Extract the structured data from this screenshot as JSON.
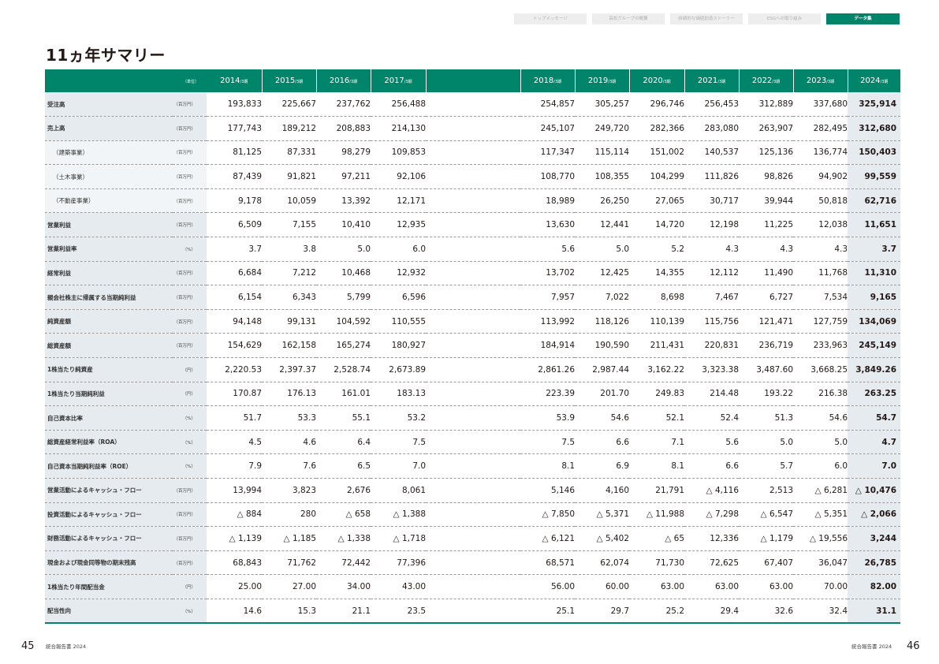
{
  "nav": {
    "tabs": [
      {
        "label": "トップメッセージ",
        "active": false
      },
      {
        "label": "高松グループの概要",
        "active": false
      },
      {
        "label": "持続的な価値創造ストーリー",
        "active": false
      },
      {
        "label": "ESGへの取り組み",
        "active": false
      },
      {
        "label": "データ集",
        "active": true
      }
    ]
  },
  "page_title": "11ヵ年サマリー",
  "table": {
    "unit_header": "（単位）",
    "years": [
      {
        "y": "2014",
        "s": "/3期"
      },
      {
        "y": "2015",
        "s": "/3期"
      },
      {
        "y": "2016",
        "s": "/3期"
      },
      {
        "y": "2017",
        "s": "/3期"
      },
      {
        "y": "2018",
        "s": "/3期"
      },
      {
        "y": "2019",
        "s": "/3期"
      },
      {
        "y": "2020",
        "s": "/3期"
      },
      {
        "y": "2021",
        "s": "/3期"
      },
      {
        "y": "2022",
        "s": "/3期"
      },
      {
        "y": "2023",
        "s": "/3期"
      },
      {
        "y": "2024",
        "s": "/3期"
      }
    ],
    "rows": [
      {
        "label": "受注高",
        "unit": "（百万円）",
        "sub": false,
        "values": [
          "193,833",
          "225,667",
          "237,762",
          "256,488",
          "254,857",
          "305,257",
          "296,746",
          "256,453",
          "312,889",
          "337,680",
          "325,914"
        ]
      },
      {
        "label": "売上高",
        "unit": "（百万円）",
        "sub": false,
        "values": [
          "177,743",
          "189,212",
          "208,883",
          "214,130",
          "245,107",
          "249,720",
          "282,366",
          "283,080",
          "263,907",
          "282,495",
          "312,680"
        ]
      },
      {
        "label": "（建築事業）",
        "unit": "（百万円）",
        "sub": true,
        "values": [
          "81,125",
          "87,331",
          "98,279",
          "109,853",
          "117,347",
          "115,114",
          "151,002",
          "140,537",
          "125,136",
          "136,774",
          "150,403"
        ]
      },
      {
        "label": "（土木事業）",
        "unit": "（百万円）",
        "sub": true,
        "values": [
          "87,439",
          "91,821",
          "97,211",
          "92,106",
          "108,770",
          "108,355",
          "104,299",
          "111,826",
          "98,826",
          "94,902",
          "99,559"
        ]
      },
      {
        "label": "（不動産事業）",
        "unit": "（百万円）",
        "sub": true,
        "values": [
          "9,178",
          "10,059",
          "13,392",
          "12,171",
          "18,989",
          "26,250",
          "27,065",
          "30,717",
          "39,944",
          "50,818",
          "62,716"
        ]
      },
      {
        "label": "営業利益",
        "unit": "（百万円）",
        "sub": false,
        "values": [
          "6,509",
          "7,155",
          "10,410",
          "12,935",
          "13,630",
          "12,441",
          "14,720",
          "12,198",
          "11,225",
          "12,038",
          "11,651"
        ]
      },
      {
        "label": "営業利益率",
        "unit": "（%）",
        "sub": false,
        "values": [
          "3.7",
          "3.8",
          "5.0",
          "6.0",
          "5.6",
          "5.0",
          "5.2",
          "4.3",
          "4.3",
          "4.3",
          "3.7"
        ]
      },
      {
        "label": "経常利益",
        "unit": "（百万円）",
        "sub": false,
        "values": [
          "6,684",
          "7,212",
          "10,468",
          "12,932",
          "13,702",
          "12,425",
          "14,355",
          "12,112",
          "11,490",
          "11,768",
          "11,310"
        ]
      },
      {
        "label": "親会社株主に帰属する当期純利益",
        "unit": "（百万円）",
        "sub": false,
        "values": [
          "6,154",
          "6,343",
          "5,799",
          "6,596",
          "7,957",
          "7,022",
          "8,698",
          "7,467",
          "6,727",
          "7,534",
          "9,165"
        ]
      },
      {
        "label": "純資産額",
        "unit": "（百万円）",
        "sub": false,
        "values": [
          "94,148",
          "99,131",
          "104,592",
          "110,555",
          "113,992",
          "118,126",
          "110,139",
          "115,756",
          "121,471",
          "127,759",
          "134,069"
        ]
      },
      {
        "label": "総資産額",
        "unit": "（百万円）",
        "sub": false,
        "values": [
          "154,629",
          "162,158",
          "165,274",
          "180,927",
          "184,914",
          "190,590",
          "211,431",
          "220,831",
          "236,719",
          "233,963",
          "245,149"
        ]
      },
      {
        "label": "1株当たり純資産",
        "unit": "（円）",
        "sub": false,
        "values": [
          "2,220.53",
          "2,397.37",
          "2,528.74",
          "2,673.89",
          "2,861.26",
          "2,987.44",
          "3,162.22",
          "3,323.38",
          "3,487.60",
          "3,668.25",
          "3,849.26"
        ]
      },
      {
        "label": "1株当たり当期純利益",
        "unit": "（円）",
        "sub": false,
        "values": [
          "170.87",
          "176.13",
          "161.01",
          "183.13",
          "223.39",
          "201.70",
          "249.83",
          "214.48",
          "193.22",
          "216.38",
          "263.25"
        ]
      },
      {
        "label": "自己資本比率",
        "unit": "（%）",
        "sub": false,
        "values": [
          "51.7",
          "53.3",
          "55.1",
          "53.2",
          "53.9",
          "54.6",
          "52.1",
          "52.4",
          "51.3",
          "54.6",
          "54.7"
        ]
      },
      {
        "label": "総資産経常利益率（ROA）",
        "unit": "（%）",
        "sub": false,
        "values": [
          "4.5",
          "4.6",
          "6.4",
          "7.5",
          "7.5",
          "6.6",
          "7.1",
          "5.6",
          "5.0",
          "5.0",
          "4.7"
        ]
      },
      {
        "label": "自己資本当期純利益率（ROE）",
        "unit": "（%）",
        "sub": false,
        "values": [
          "7.9",
          "7.6",
          "6.5",
          "7.0",
          "8.1",
          "6.9",
          "8.1",
          "6.6",
          "5.7",
          "6.0",
          "7.0"
        ]
      },
      {
        "label": "営業活動によるキャッシュ・フロー",
        "unit": "（百万円）",
        "sub": false,
        "values": [
          "13,994",
          "3,823",
          "2,676",
          "8,061",
          "5,146",
          "4,160",
          "21,791",
          "△ 4,116",
          "2,513",
          "△ 6,281",
          "△ 10,476"
        ]
      },
      {
        "label": "投資活動によるキャッシュ・フロー",
        "unit": "（百万円）",
        "sub": false,
        "values": [
          "△ 884",
          "280",
          "△ 658",
          "△ 1,388",
          "△ 7,850",
          "△ 5,371",
          "△ 11,988",
          "△ 7,298",
          "△ 6,547",
          "△ 5,351",
          "△ 2,066"
        ]
      },
      {
        "label": "財務活動によるキャッシュ・フロー",
        "unit": "（百万円）",
        "sub": false,
        "values": [
          "△ 1,139",
          "△ 1,185",
          "△ 1,338",
          "△ 1,718",
          "△ 6,121",
          "△ 5,402",
          "△ 65",
          "12,336",
          "△ 1,179",
          "△ 19,556",
          "3,244"
        ]
      },
      {
        "label": "現金および現金同等物の期末残高",
        "unit": "（百万円）",
        "sub": false,
        "values": [
          "68,843",
          "71,762",
          "72,442",
          "77,396",
          "68,571",
          "62,074",
          "71,730",
          "72,625",
          "67,407",
          "36,047",
          "26,785"
        ]
      },
      {
        "label": "1株当たり年間配当金",
        "unit": "（円）",
        "sub": false,
        "values": [
          "25.00",
          "27.00",
          "34.00",
          "43.00",
          "56.00",
          "60.00",
          "63.00",
          "63.00",
          "63.00",
          "70.00",
          "82.00"
        ]
      },
      {
        "label": "配当性向",
        "unit": "（%）",
        "sub": false,
        "values": [
          "14.6",
          "15.3",
          "21.1",
          "23.5",
          "25.1",
          "29.7",
          "25.2",
          "29.4",
          "32.6",
          "32.4",
          "31.1"
        ]
      }
    ]
  },
  "footer": {
    "left_page": "45",
    "right_page": "46",
    "report_name": "統合報告書 2024"
  }
}
